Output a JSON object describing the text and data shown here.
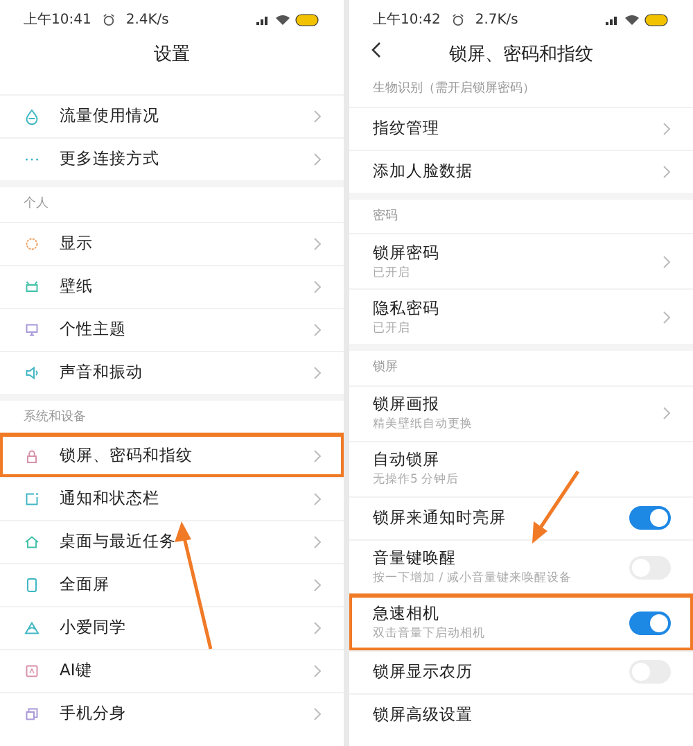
{
  "screens": [
    {
      "status_bar": {
        "time": "上午10:41",
        "speed": "2.4K/s"
      },
      "title": "设置",
      "sections": [
        {
          "items": [
            {
              "kind": "link",
              "label": "流量使用情况",
              "color": "#3fb6c4",
              "highlighted": false
            },
            {
              "kind": "link",
              "label": "更多连接方式",
              "color": "#3fb6c4",
              "highlighted": false
            }
          ]
        },
        {
          "header": "个人",
          "items": [
            {
              "kind": "link",
              "label": "显示",
              "color": "#f0a060",
              "highlighted": false
            },
            {
              "kind": "link",
              "label": "壁纸",
              "color": "#40c0a8",
              "highlighted": false
            },
            {
              "kind": "link",
              "label": "个性主题",
              "color": "#a898d8",
              "highlighted": false
            },
            {
              "kind": "link",
              "label": "声音和振动",
              "color": "#3fb6c4",
              "highlighted": false
            }
          ]
        },
        {
          "header": "系统和设备",
          "items": [
            {
              "kind": "link",
              "label": "锁屏、密码和指纹",
              "color": "#d890a8",
              "highlighted": true
            },
            {
              "kind": "link",
              "label": "通知和状态栏",
              "color": "#3fb6c4",
              "highlighted": false
            },
            {
              "kind": "link",
              "label": "桌面与最近任务",
              "color": "#40c0a8",
              "highlighted": false
            },
            {
              "kind": "link",
              "label": "全面屏",
              "color": "#3fb6c4",
              "highlighted": false
            },
            {
              "kind": "link",
              "label": "小爱同学",
              "color": "#3fb6c4",
              "highlighted": false
            },
            {
              "kind": "link",
              "label": "AI键",
              "color": "#d890a8",
              "highlighted": false
            },
            {
              "kind": "link",
              "label": "手机分身",
              "color": "#a898d8",
              "highlighted": false
            }
          ]
        }
      ]
    },
    {
      "status_bar": {
        "time": "上午10:42",
        "speed": "2.7K/s"
      },
      "title": "锁屏、密码和指纹",
      "back_button": true,
      "sections": [
        {
          "header": "生物识别（需开启锁屏密码）",
          "items": [
            {
              "kind": "link",
              "label": "指纹管理",
              "highlighted": false
            },
            {
              "kind": "link",
              "label": "添加人脸数据",
              "highlighted": false
            }
          ]
        },
        {
          "header": "密码",
          "items": [
            {
              "kind": "link",
              "label": "锁屏密码",
              "subtitle": "已开启",
              "highlighted": false
            },
            {
              "kind": "link",
              "label": "隐私密码",
              "subtitle": "已开启",
              "highlighted": false
            }
          ]
        },
        {
          "header": "锁屏",
          "items": [
            {
              "kind": "link",
              "label": "锁屏画报",
              "subtitle": "精美壁纸自动更换",
              "highlighted": false
            },
            {
              "kind": "plain",
              "label": "自动锁屏",
              "subtitle": "无操作5 分钟后",
              "highlighted": false
            },
            {
              "kind": "toggle",
              "label": "锁屏来通知时亮屏",
              "on": true,
              "highlighted": false
            },
            {
              "kind": "toggle",
              "label": "音量键唤醒",
              "subtitle": "按一下增加 / 减小音量键来唤醒设备",
              "on": false,
              "highlighted": false
            },
            {
              "kind": "toggle",
              "label": "急速相机",
              "subtitle": "双击音量下启动相机",
              "on": true,
              "highlighted": true
            },
            {
              "kind": "toggle",
              "label": "锁屏显示农历",
              "on": false,
              "highlighted": false
            },
            {
              "kind": "plain",
              "label": "锁屏高级设置",
              "highlighted": false
            }
          ]
        }
      ]
    }
  ]
}
